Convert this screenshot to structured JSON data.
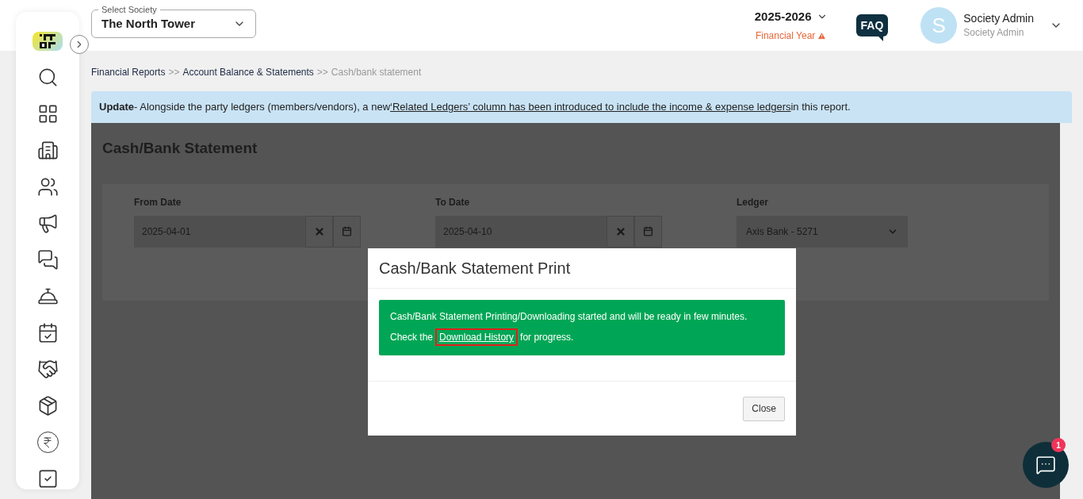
{
  "society_select": {
    "label": "Select Society",
    "value": "The North Tower"
  },
  "financial_year": {
    "value": "2025-2026",
    "label": "Financial Year",
    "warning": true
  },
  "faq": "FAQ",
  "user": {
    "initial": "S",
    "name": "Society Admin",
    "role": "Society Admin"
  },
  "breadcrumb": [
    {
      "label": "Financial Reports",
      "current": false,
      "separator": ">>"
    },
    {
      "label": "Account Balance & Statements",
      "current": false,
      "separator": ">>"
    },
    {
      "label": "Cash/bank statement",
      "current": true
    }
  ],
  "notice": {
    "lead": "Update",
    "text_before": " - Alongside the party ledgers (members/vendors), a new ",
    "link": "‘Related Ledgers’ column has been introduced to include the income & expense ledgers",
    "text_after": " in this report."
  },
  "page_title": "Cash/Bank Statement",
  "filters": [
    {
      "kind": "date",
      "label": "From Date",
      "value": "2025-04-01"
    },
    {
      "kind": "date",
      "label": "To Date",
      "value": "2025-04-10"
    },
    {
      "kind": "select",
      "label": "Ledger",
      "value": "Axis Bank - 5271"
    }
  ],
  "modal": {
    "title": "Cash/Bank Statement Print",
    "message": "Cash/Bank Statement Printing/Downloading started and will be ready in few minutes.",
    "check_before": "Check the",
    "link": {
      "label": "Download History",
      "highlighted": true
    },
    "check_after": "for progress.",
    "close": "Close"
  },
  "chat": {
    "badge": "1"
  }
}
